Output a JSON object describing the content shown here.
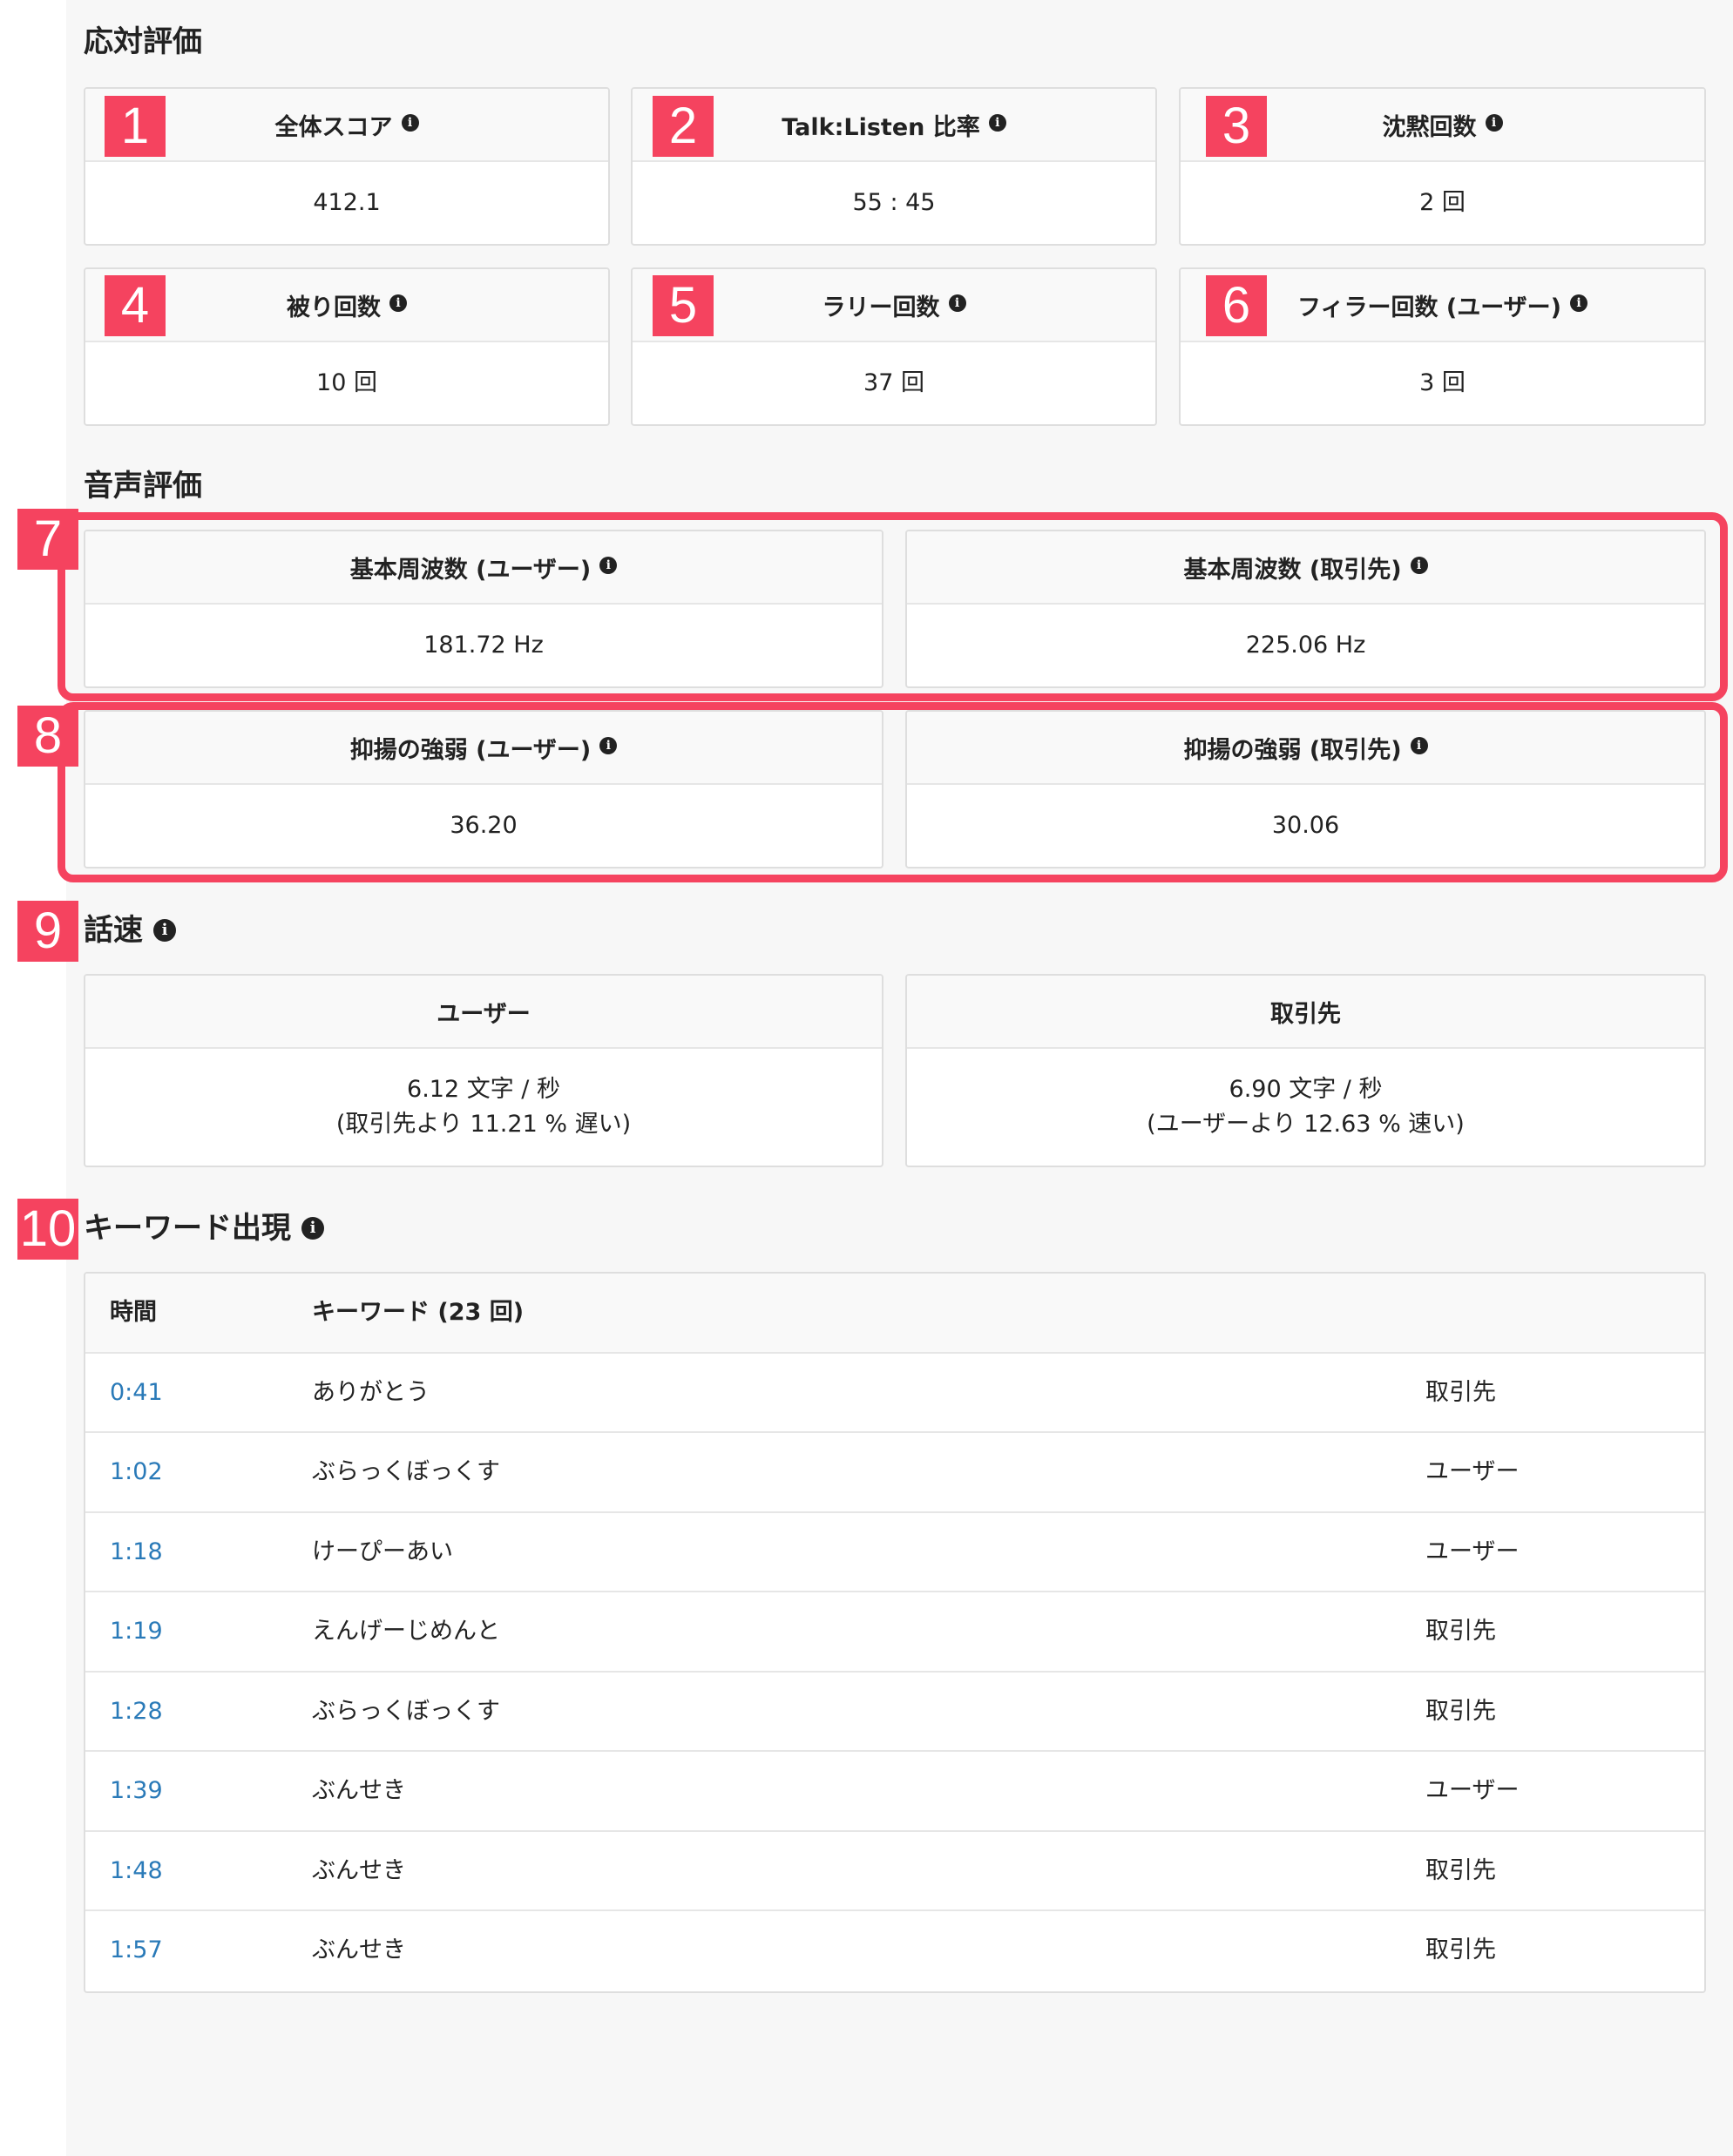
{
  "colors": {
    "accent": "#f5435f",
    "link": "#2a7ab8"
  },
  "response_eval": {
    "title": "応対評価",
    "cards": [
      {
        "badge": "1",
        "label": "全体スコア",
        "value": "412.1"
      },
      {
        "badge": "2",
        "label": "Talk:Listen 比率",
        "value": "55 : 45"
      },
      {
        "badge": "3",
        "label": "沈黙回数",
        "value": "2 回"
      },
      {
        "badge": "4",
        "label": "被り回数",
        "value": "10 回"
      },
      {
        "badge": "5",
        "label": "ラリー回数",
        "value": "37 回"
      },
      {
        "badge": "6",
        "label": "フィラー回数 (ユーザー)",
        "value": "3 回"
      }
    ]
  },
  "voice_eval": {
    "title": "音声評価",
    "badge_pitch": "7",
    "badge_intonation": "8",
    "pitch_user": {
      "label": "基本周波数 (ユーザー)",
      "value": "181.72 Hz"
    },
    "pitch_client": {
      "label": "基本周波数 (取引先)",
      "value": "225.06 Hz"
    },
    "intonation_user": {
      "label": "抑揚の強弱 (ユーザー)",
      "value": "36.20"
    },
    "intonation_client": {
      "label": "抑揚の強弱 (取引先)",
      "value": "30.06"
    }
  },
  "speech_rate": {
    "badge": "9",
    "title": "話速",
    "user": {
      "label": "ユーザー",
      "value": "6.12 文字 / 秒",
      "compare": "(取引先より 11.21 % 遅い)"
    },
    "client": {
      "label": "取引先",
      "value": "6.90 文字 / 秒",
      "compare": "(ユーザーより 12.63 % 速い)"
    }
  },
  "keywords": {
    "badge": "10",
    "title": "キーワード出現",
    "header_time": "時間",
    "header_keyword": "キーワード (23 回)",
    "rows": [
      {
        "time": "0:41",
        "keyword": "ありがとう",
        "speaker": "取引先"
      },
      {
        "time": "1:02",
        "keyword": "ぶらっくぼっくす",
        "speaker": "ユーザー"
      },
      {
        "time": "1:18",
        "keyword": "けーぴーあい",
        "speaker": "ユーザー"
      },
      {
        "time": "1:19",
        "keyword": "えんげーじめんと",
        "speaker": "取引先"
      },
      {
        "time": "1:28",
        "keyword": "ぶらっくぼっくす",
        "speaker": "取引先"
      },
      {
        "time": "1:39",
        "keyword": "ぶんせき",
        "speaker": "ユーザー"
      },
      {
        "time": "1:48",
        "keyword": "ぶんせき",
        "speaker": "取引先"
      },
      {
        "time": "1:57",
        "keyword": "ぶんせき",
        "speaker": "取引先"
      }
    ]
  },
  "icons": {
    "info": "info-icon"
  }
}
